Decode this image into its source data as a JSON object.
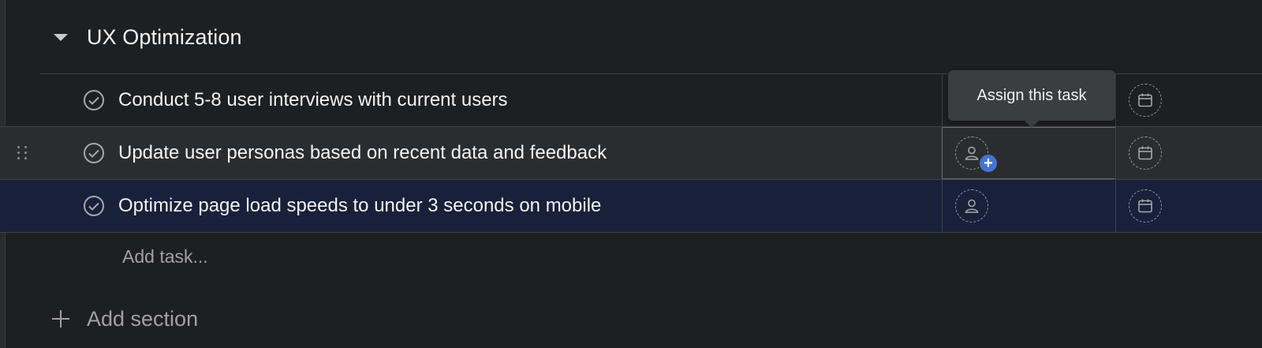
{
  "section": {
    "title": "UX Optimization"
  },
  "tasks": [
    {
      "name": "Conduct 5-8 user interviews with current users"
    },
    {
      "name": "Update user personas based on recent data and feedback"
    },
    {
      "name": "Optimize page load speeds to under 3 seconds on mobile"
    }
  ],
  "tooltip": {
    "text": "Assign this task"
  },
  "add_task_label": "Add task...",
  "add_section_label": "Add section",
  "icons": {
    "collapse": "caret-down-icon",
    "complete": "check-circle-icon",
    "assignee": "user-icon",
    "due_date": "calendar-icon",
    "add": "plus-icon",
    "drag": "drag-handle-icon"
  },
  "colors": {
    "accent": "#4573d2",
    "background": "#1e1f21",
    "selected_row": "#17213a"
  }
}
